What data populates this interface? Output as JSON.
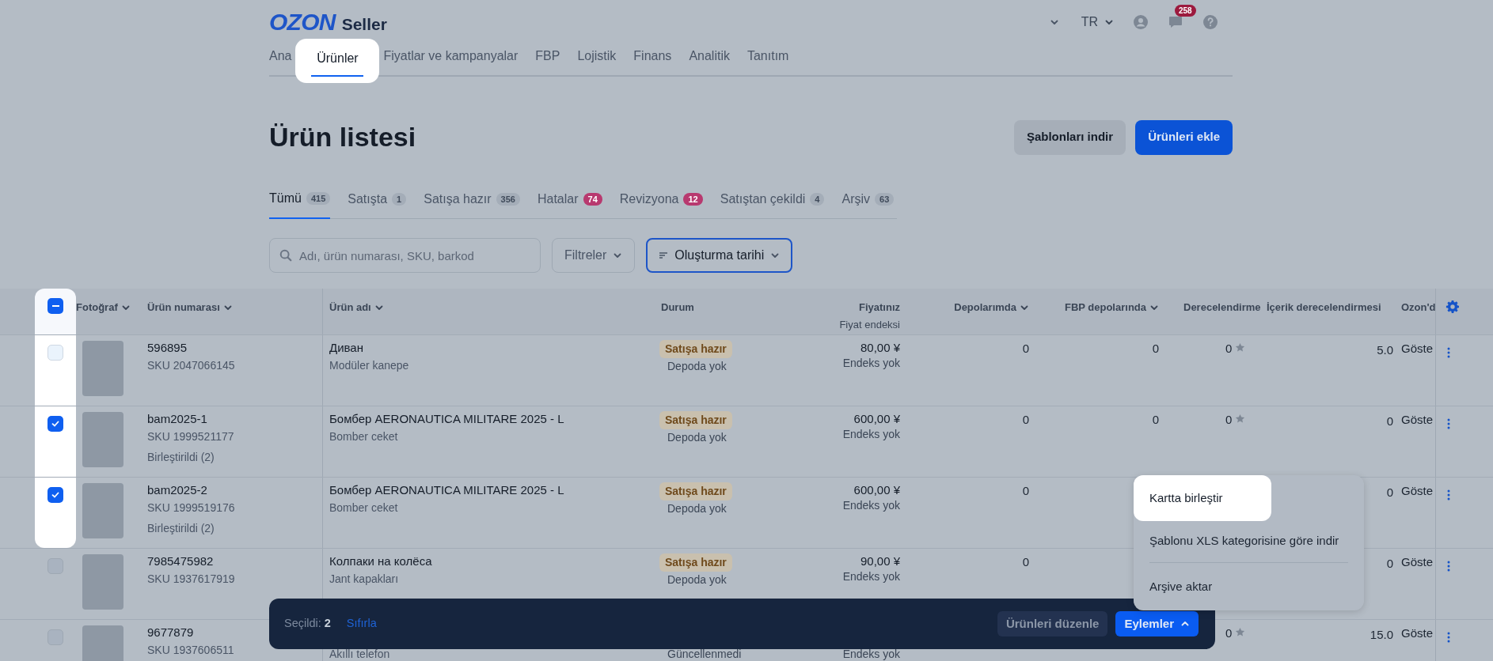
{
  "header": {
    "logo": "OZON",
    "logo_suffix": "Seller",
    "language": "TR",
    "chat_badge": "258"
  },
  "nav": [
    {
      "label": "Ana",
      "selected": false
    },
    {
      "label": "Ürünler",
      "selected": true
    },
    {
      "label": "Fiyatlar ve kampanyalar",
      "selected": false
    },
    {
      "label": "FBP",
      "selected": false
    },
    {
      "label": "Lojistik",
      "selected": false
    },
    {
      "label": "Finans",
      "selected": false
    },
    {
      "label": "Analitik",
      "selected": false
    },
    {
      "label": "Tanıtım",
      "selected": false
    }
  ],
  "page_title": "Ürün listesi",
  "header_buttons": [
    {
      "label": "Şablonları indir",
      "kind": "secondary"
    },
    {
      "label": "Ürünleri ekle",
      "kind": "primary"
    }
  ],
  "status_tabs": [
    {
      "label": "Tümü",
      "count": "415",
      "selected": true,
      "color": "#a4adb8"
    },
    {
      "label": "Satışta",
      "count": "1",
      "selected": false,
      "color": "#a4adb8"
    },
    {
      "label": "Satışa hazır",
      "count": "356",
      "selected": false,
      "color": "#a4adb8"
    },
    {
      "label": "Hatalar",
      "count": "74",
      "selected": false,
      "color": "#b8396f"
    },
    {
      "label": "Revizyona",
      "count": "12",
      "selected": false,
      "color": "#b8396f"
    },
    {
      "label": "Satıştan çekildi",
      "count": "4",
      "selected": false,
      "color": "#a4adb8"
    },
    {
      "label": "Arşiv",
      "count": "63",
      "selected": false,
      "color": "#a4adb8"
    }
  ],
  "search": {
    "placeholder": "Adı, ürün numarası, SKU, barkod"
  },
  "filters_button": "Filtreler",
  "sort_button": "Oluşturma tarihi",
  "table": {
    "select_all": {
      "checked": true,
      "indeterminate": true
    },
    "columns": [
      {
        "label": "Fotoğraf",
        "sortable": true
      },
      {
        "label": "Ürün numarası",
        "sortable": true
      },
      {
        "label": "Ürün adı",
        "sortable": true
      },
      {
        "label": "Durum",
        "sortable": false
      },
      {
        "label": "Fiyatınız",
        "sub": "Fiyat endeksi",
        "sortable": false
      },
      {
        "label": "Depolarımda",
        "sortable": true
      },
      {
        "label": "FBP depolarında",
        "sortable": true
      },
      {
        "label": "Derecelendirme",
        "sortable": false
      },
      {
        "label": "İçerik derecelendirmesi",
        "sortable": false
      },
      {
        "label": "Ozon'd",
        "sortable": false
      }
    ],
    "rows": [
      {
        "checked": false,
        "spotlight": true,
        "number": "596895",
        "sku": "SKU 2047066145",
        "name": "Диван",
        "category": "Modüler kanepe",
        "status": "Satışa hazır",
        "stock_note": "Depoda yok",
        "price": "80,00 ¥",
        "price_index": "Endeks yok",
        "my_stock": "0",
        "fbp_stock": "0",
        "rating": "0",
        "content_rating": "5.0",
        "ozon": "Göste"
      },
      {
        "checked": true,
        "spotlight": true,
        "number": "bam2025-1",
        "sku": "SKU 1999521177",
        "merged": "Birleştirildi (2)",
        "name": "Бомбер AERONAUTICA MILITARE 2025 - L",
        "category": "Bomber ceket",
        "status": "Satışa hazır",
        "stock_note": "Depoda yok",
        "price": "600,00 ¥",
        "price_index": "Endeks yok",
        "my_stock": "0",
        "fbp_stock": "0",
        "rating": "0",
        "content_rating": "0",
        "ozon": "Göste"
      },
      {
        "checked": true,
        "spotlight": true,
        "number": "bam2025-2",
        "sku": "SKU 1999519176",
        "merged": "Birleştirildi (2)",
        "name": "Бомбер AERONAUTICA MILITARE 2025 - L",
        "category": "Bomber ceket",
        "status": "Satışa hazır",
        "stock_note": "Depoda yok",
        "price": "600,00 ¥",
        "price_index": "Endeks yok",
        "my_stock": "0",
        "content_rating": "0",
        "ozon": "Göste"
      },
      {
        "checked": false,
        "spotlight": false,
        "number": "7985475982",
        "sku": "SKU 1937617919",
        "name": "Колпаки на колёса",
        "category": "Jant kapakları",
        "status": "Satışa hazır",
        "stock_note": "Depoda yok",
        "price": "90,00 ¥",
        "price_index": "Endeks yok",
        "my_stock": "0",
        "content_rating": "0",
        "ozon": "Göste"
      },
      {
        "checked": false,
        "spotlight": false,
        "number": "9677879",
        "sku": "SKU 1937606511",
        "category": "Akıllı telefon",
        "stock_note": "Güncellenmedi",
        "price_index": "Endeks yok",
        "rating": "0",
        "content_rating": "15.0",
        "ozon": "Göste"
      }
    ]
  },
  "selection_bar": {
    "label": "Seçildi:",
    "count": "2",
    "reset": "Sıfırla",
    "edit_button": "Ürünleri düzenle",
    "actions_button": "Eylemler"
  },
  "actions_menu": [
    {
      "label": "Kartta birleştir",
      "selected": true
    },
    {
      "label": "Şablonu XLS kategorisine göre indir",
      "selected": false
    },
    {
      "label": "Arşive aktar",
      "selected": false
    }
  ]
}
